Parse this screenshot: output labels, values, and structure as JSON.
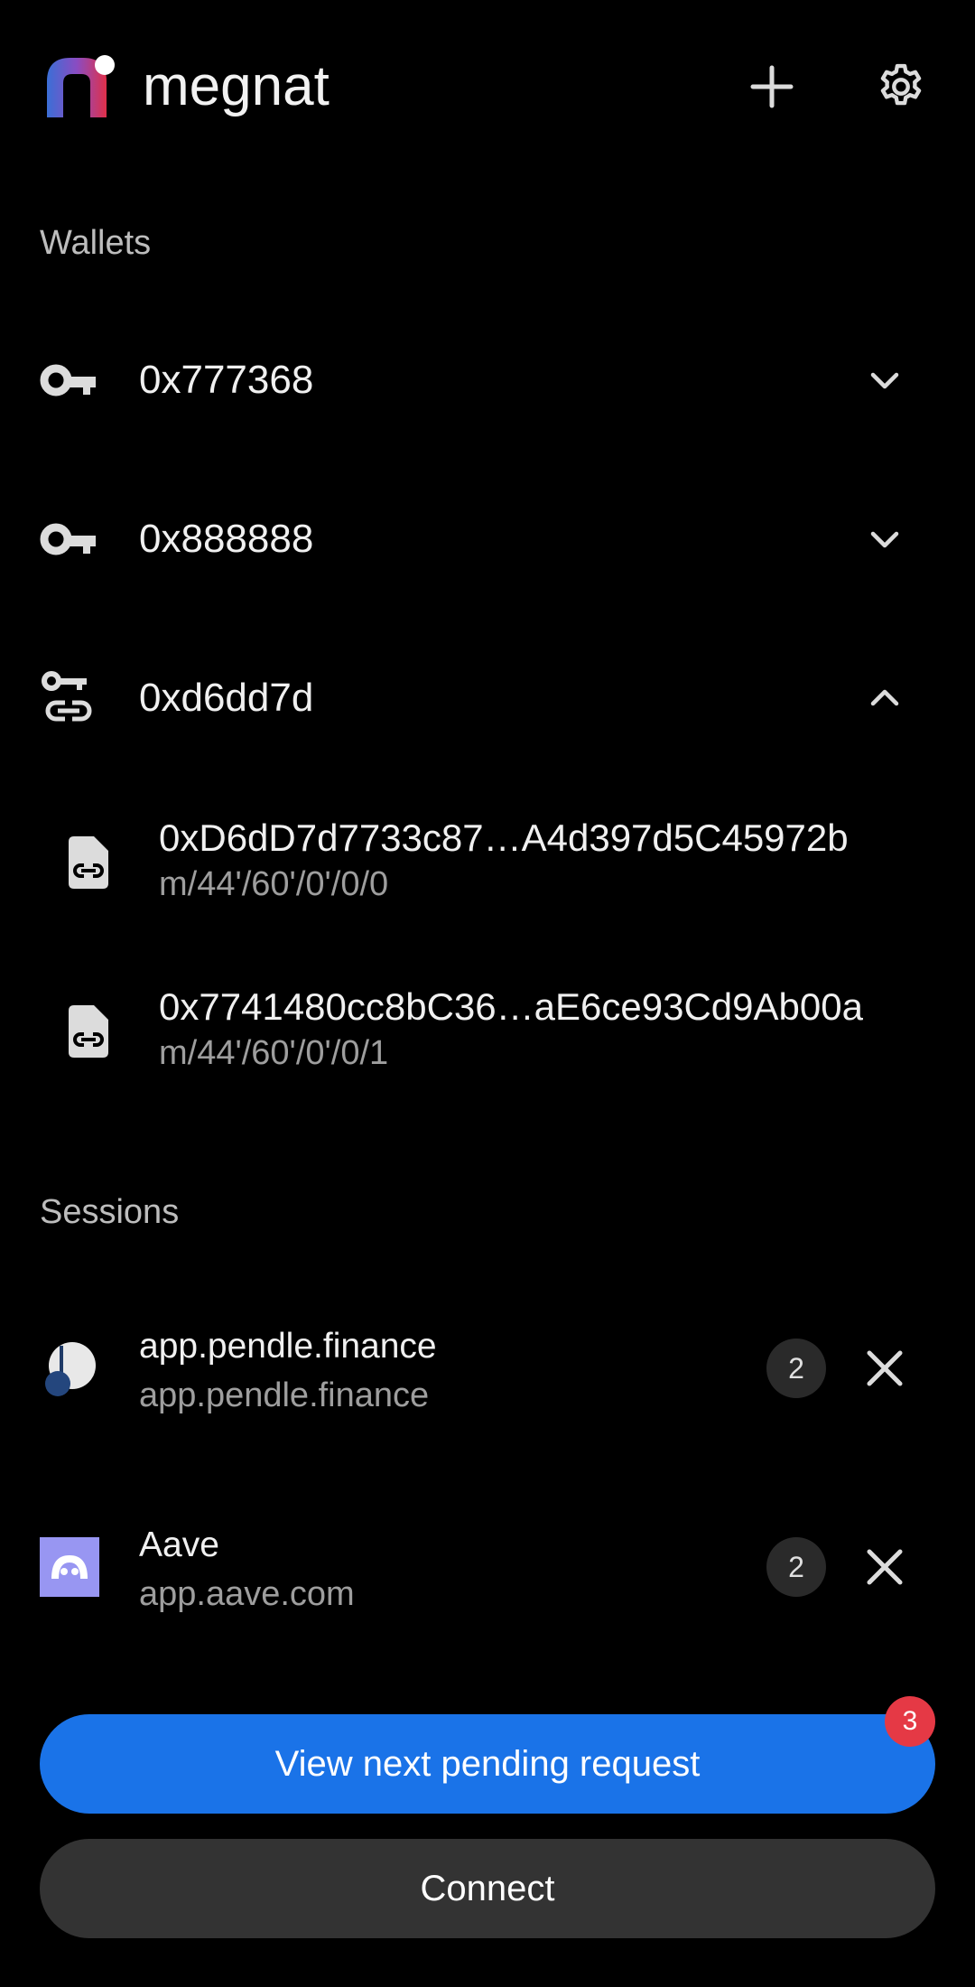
{
  "header": {
    "app_name": "megnat",
    "logo_icon": "megnat-logo",
    "add_icon": "plus-icon",
    "settings_icon": "gear-icon"
  },
  "wallets_section": {
    "label": "Wallets",
    "items": [
      {
        "label": "0x777368",
        "icon": "key-icon",
        "chevron": "chevron-down-icon"
      },
      {
        "label": "0x888888",
        "icon": "key-icon",
        "chevron": "chevron-down-icon"
      },
      {
        "label": "0xd6dd7d",
        "icon": "key-link-icon",
        "chevron": "chevron-up-icon",
        "accounts": [
          {
            "address": "0xD6dD7d7733c87…A4d397d5C45972b",
            "path": "m/44'/60'/0'/0/0",
            "icon": "file-link-icon"
          },
          {
            "address": "0x7741480cc8bC36…aE6ce93Cd9Ab00a",
            "path": "m/44'/60'/0'/0/1",
            "icon": "file-link-icon"
          }
        ]
      }
    ]
  },
  "sessions_section": {
    "label": "Sessions",
    "items": [
      {
        "name": "app.pendle.finance",
        "url": "app.pendle.finance",
        "count": "2",
        "icon": "pendle-logo",
        "close_icon": "close-icon"
      },
      {
        "name": "Aave",
        "url": "app.aave.com",
        "count": "2",
        "icon": "aave-logo",
        "close_icon": "close-icon"
      }
    ]
  },
  "actions": {
    "primary_label": "View next pending request",
    "pending_count": "3",
    "secondary_label": "Connect"
  },
  "colors": {
    "background": "#000000",
    "primary": "#1a73e8",
    "badge_red": "#e53945",
    "secondary_button": "#333333",
    "muted_text": "#9e9e9e"
  }
}
